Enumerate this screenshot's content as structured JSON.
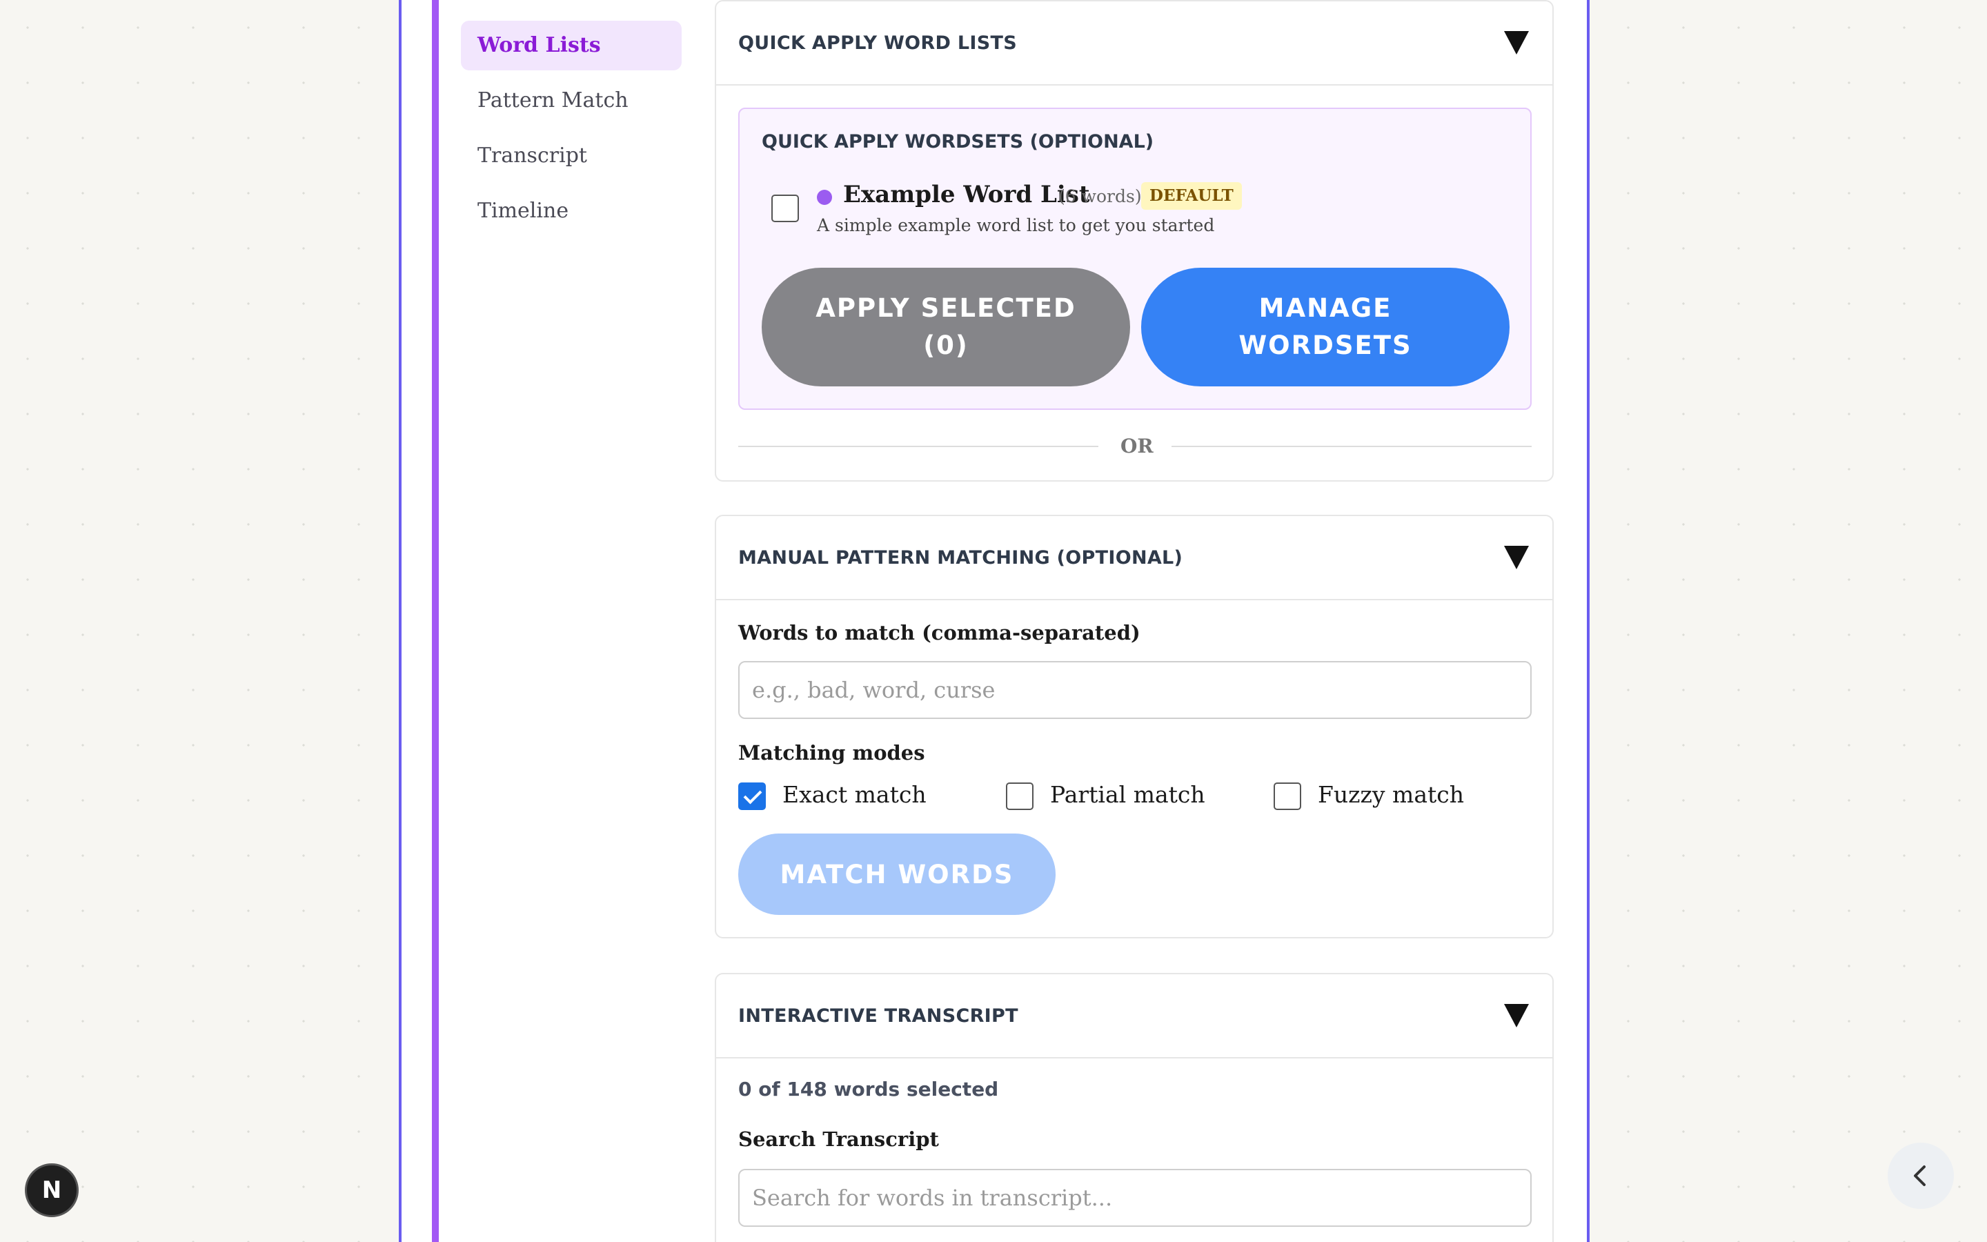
{
  "sidebar": {
    "items": [
      {
        "label": "Word Lists",
        "active": true
      },
      {
        "label": "Pattern Match",
        "active": false
      },
      {
        "label": "Transcript",
        "active": false
      },
      {
        "label": "Timeline",
        "active": false
      }
    ]
  },
  "quick_apply": {
    "title": "QUICK APPLY WORD LISTS",
    "wordsets_title": "QUICK APPLY WORDSETS (OPTIONAL)",
    "wordset": {
      "name": "Example Word List",
      "count": "(6 words)",
      "badge": "DEFAULT",
      "description": "A simple example word list to get you started",
      "checked": false,
      "color": "#9b5cf0"
    },
    "apply_button": "APPLY SELECTED (0)",
    "manage_button": "MANAGE WORDSETS",
    "or_text": "OR"
  },
  "pattern_matching": {
    "title": "MANUAL PATTERN MATCHING (OPTIONAL)",
    "words_label": "Words to match (comma-separated)",
    "words_placeholder": "e.g., bad, word, curse",
    "modes_label": "Matching modes",
    "modes": [
      {
        "label": "Exact match",
        "checked": true
      },
      {
        "label": "Partial match",
        "checked": false
      },
      {
        "label": "Fuzzy match",
        "checked": false
      }
    ],
    "match_button": "MATCH WORDS"
  },
  "transcript": {
    "title": "INTERACTIVE TRANSCRIPT",
    "selected_count": "0 of 148 words selected",
    "search_label": "Search Transcript",
    "search_placeholder": "Search for words in transcript..."
  },
  "floating": {
    "n_badge": "N",
    "collapse_icon": "chevron-left-icon"
  },
  "colors": {
    "accent_purple": "#a259f4",
    "frame_border": "#6a5cf0",
    "primary_blue": "#3582f5",
    "disabled_gray": "#858589",
    "disabled_blue": "#a7c8fb"
  }
}
